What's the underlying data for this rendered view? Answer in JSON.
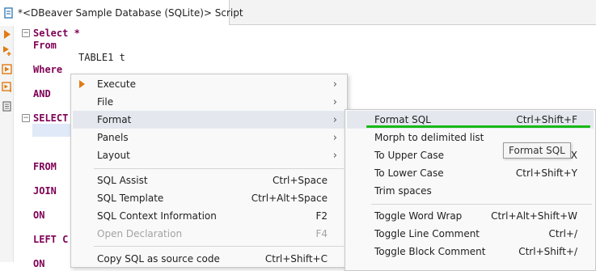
{
  "tab": {
    "title": "*<DBeaver Sample Database (SQLite)> Script"
  },
  "editor": {
    "lines": {
      "select": "Select *",
      "from": "From",
      "table": "TABLE1 t",
      "where": "Where",
      "and": "AND",
      "select2": "SELECT",
      "from2": "FROM",
      "join": "JOIN",
      "on": "ON",
      "leftjoin": "LEFT C",
      "on2": "ON"
    }
  },
  "context_menu": {
    "items": [
      {
        "label": "Execute",
        "shortcut": "",
        "submenu": true,
        "icon": "execute-icon"
      },
      {
        "label": "File",
        "shortcut": "",
        "submenu": true
      },
      {
        "label": "Format",
        "shortcut": "",
        "submenu": true,
        "highlighted": true
      },
      {
        "label": "Panels",
        "shortcut": "",
        "submenu": true
      },
      {
        "label": "Layout",
        "shortcut": "",
        "submenu": true
      },
      {
        "label": "SQL Assist",
        "shortcut": "Ctrl+Space"
      },
      {
        "label": "SQL Template",
        "shortcut": "Ctrl+Alt+Space"
      },
      {
        "label": "SQL Context Information",
        "shortcut": "F2"
      },
      {
        "label": "Open Declaration",
        "shortcut": "F4",
        "disabled": true
      },
      {
        "label": "Copy SQL as source code",
        "shortcut": "Ctrl+Shift+C"
      }
    ]
  },
  "format_submenu": {
    "items": [
      {
        "label": "Format SQL",
        "shortcut": "Ctrl+Shift+F",
        "highlighted": true
      },
      {
        "label": "Morph to delimited list",
        "shortcut": ""
      },
      {
        "label": "To Upper Case",
        "shortcut": "Ctrl+Shift+X"
      },
      {
        "label": "To Lower Case",
        "shortcut": "Ctrl+Shift+Y"
      },
      {
        "label": "Trim spaces",
        "shortcut": ""
      },
      {
        "label": "Toggle Word Wrap",
        "shortcut": "Ctrl+Alt+Shift+W"
      },
      {
        "label": "Toggle Line Comment",
        "shortcut": "Ctrl+/"
      },
      {
        "label": "Toggle Block Comment",
        "shortcut": "Ctrl+Shift+/"
      }
    ]
  },
  "tooltip": {
    "text": "Format SQL"
  },
  "colors": {
    "keyword": "#7f0055",
    "accent_underline": "#16b916",
    "execute_icon": "#e07b13"
  }
}
